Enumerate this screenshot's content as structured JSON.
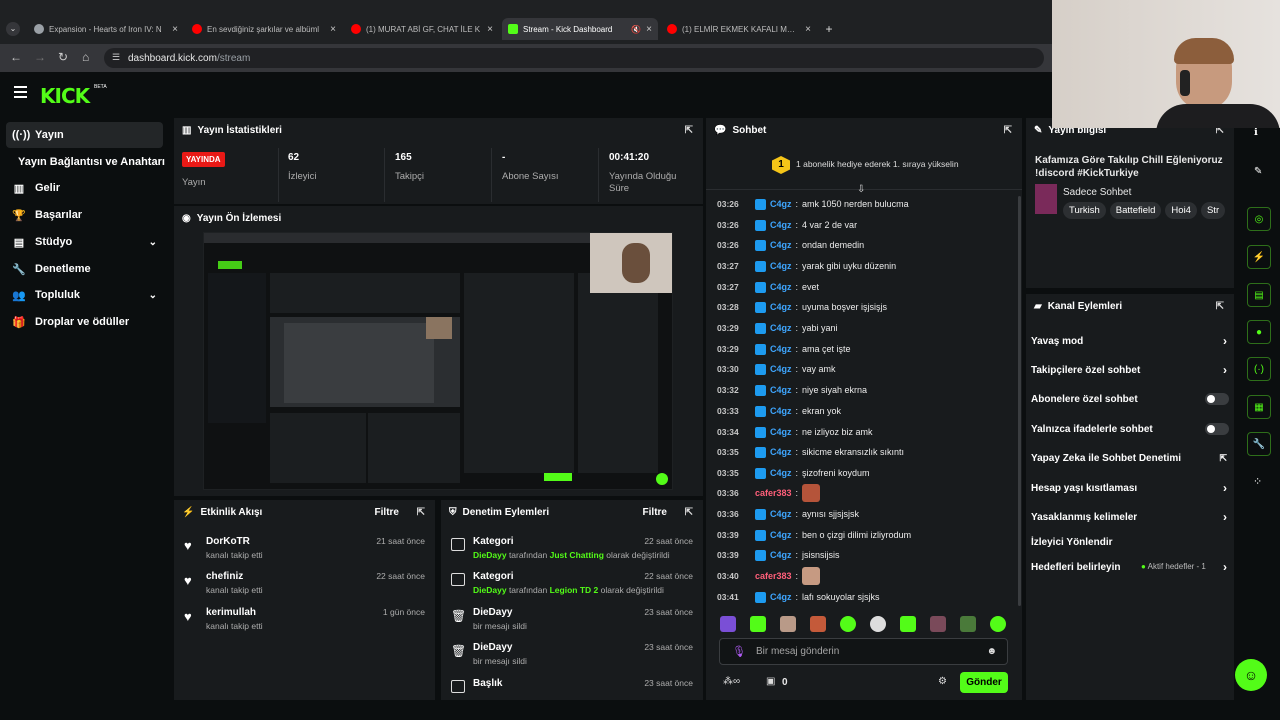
{
  "browser": {
    "tabs": [
      {
        "title": "Expansion - Hearts of Iron IV: N",
        "color": "#9aa0a6"
      },
      {
        "title": "En sevdiğiniz şarkılar ve albüml",
        "color": "#ff0000"
      },
      {
        "title": "(1) MURAT ABİ GF, CHAT İLE K",
        "color": "#ff0000"
      },
      {
        "title": "Stream - Kick Dashboard",
        "color": "#53fc18"
      },
      {
        "title": "(1) ELMİR EKMEK KAFALI MEVZ",
        "color": "#ff0000"
      }
    ],
    "url_host": "dashboard.kick.com",
    "url_path": "/stream"
  },
  "kick": {
    "logo": "KICK",
    "beta": "BETA"
  },
  "sidebar": {
    "items": [
      {
        "label": "Yayın",
        "icon": "broadcast-icon"
      },
      {
        "label": "Yayın Bağlantısı ve Anahtarı",
        "icon": ""
      },
      {
        "label": "Gelir",
        "icon": "chart-icon"
      },
      {
        "label": "Başarılar",
        "icon": "trophy-icon"
      },
      {
        "label": "Stüdyo",
        "icon": "studio-icon"
      },
      {
        "label": "Denetleme",
        "icon": "wrench-icon"
      },
      {
        "label": "Topluluk",
        "icon": "people-icon"
      },
      {
        "label": "Droplar ve ödüller",
        "icon": "gift-icon"
      }
    ]
  },
  "stats": {
    "title": "Yayın İstatistikleri",
    "live_badge": "YAYINDA",
    "live_label": "Yayın",
    "viewers": "62",
    "viewers_label": "İzleyici",
    "followers": "165",
    "followers_label": "Takipçi",
    "subs": "-",
    "subs_label": "Abone Sayısı",
    "uptime": "00:41:20",
    "uptime_label": "Yayında Olduğu Süre"
  },
  "preview": {
    "title": "Yayın Ön İzlemesi"
  },
  "activity": {
    "title": "Etkinlik Akışı",
    "filter": "Filtre",
    "items": [
      {
        "name": "DorKoTR",
        "desc": "kanalı takip etti",
        "time": "21 saat önce"
      },
      {
        "name": "chefiniz",
        "desc": "kanalı takip etti",
        "time": "22 saat önce"
      },
      {
        "name": "kerimullah",
        "desc": "kanalı takip etti",
        "time": "1 gün önce"
      }
    ]
  },
  "moderation": {
    "title": "Denetim Eylemleri",
    "filter": "Filtre",
    "items": [
      {
        "name": "Kategori",
        "actor": "DieDayy",
        "mid": "tarafından",
        "target": "Just Chatting",
        "tail": "olarak değiştirildi",
        "time": "22 saat önce"
      },
      {
        "name": "Kategori",
        "actor": "DieDayy",
        "mid": "tarafından",
        "target": "Legion TD 2",
        "tail": "olarak değiştirildi",
        "time": "22 saat önce"
      },
      {
        "name": "DieDayy",
        "actor": "",
        "mid": "bir mesajı sildi",
        "target": "",
        "tail": "",
        "time": "23 saat önce"
      },
      {
        "name": "DieDayy",
        "actor": "",
        "mid": "bir mesajı sildi",
        "target": "",
        "tail": "",
        "time": "23 saat önce"
      },
      {
        "name": "Başlık",
        "actor": "",
        "mid": "",
        "target": "",
        "tail": "",
        "time": "23 saat önce"
      }
    ]
  },
  "chat": {
    "title": "Sohbet",
    "pinned_rank": "1",
    "pinned": "1 abonelik hediye ederek 1. sıraya yükselin",
    "messages": [
      {
        "time": "03:26",
        "user": "C4gz",
        "text": "amk 1050 nerden bulucma",
        "color": "#3ea6ff"
      },
      {
        "time": "03:26",
        "user": "C4gz",
        "text": "4 var 2 de var",
        "color": "#3ea6ff"
      },
      {
        "time": "03:26",
        "user": "C4gz",
        "text": "ondan demedin",
        "color": "#3ea6ff"
      },
      {
        "time": "03:27",
        "user": "C4gz",
        "text": "yarak gibi uyku düzenin",
        "color": "#3ea6ff"
      },
      {
        "time": "03:27",
        "user": "C4gz",
        "text": "evet",
        "color": "#3ea6ff"
      },
      {
        "time": "03:28",
        "user": "C4gz",
        "text": "uyuma boşver işjsişjs",
        "color": "#3ea6ff"
      },
      {
        "time": "03:29",
        "user": "C4gz",
        "text": "yabi yani",
        "color": "#3ea6ff"
      },
      {
        "time": "03:29",
        "user": "C4gz",
        "text": "ama çet işte",
        "color": "#3ea6ff"
      },
      {
        "time": "03:30",
        "user": "C4gz",
        "text": "vay amk",
        "color": "#3ea6ff"
      },
      {
        "time": "03:32",
        "user": "C4gz",
        "text": "niye siyah ekrna",
        "color": "#3ea6ff"
      },
      {
        "time": "03:33",
        "user": "C4gz",
        "text": "ekran yok",
        "color": "#3ea6ff"
      },
      {
        "time": "03:34",
        "user": "C4gz",
        "text": "ne izliyoz biz amk",
        "color": "#3ea6ff"
      },
      {
        "time": "03:35",
        "user": "C4gz",
        "text": "sikicme ekransızlık sıkıntı",
        "color": "#3ea6ff"
      },
      {
        "time": "03:35",
        "user": "C4gz",
        "text": "şizofreni koydum",
        "color": "#3ea6ff"
      },
      {
        "time": "03:36",
        "user": "cafer383",
        "text": "",
        "color": "#ff5f7a"
      },
      {
        "time": "03:36",
        "user": "C4gz",
        "text": "aynısı sjjsjsjsk",
        "color": "#3ea6ff"
      },
      {
        "time": "03:39",
        "user": "C4gz",
        "text": "ben o çizgi dilimi izliyrodum",
        "color": "#3ea6ff"
      },
      {
        "time": "03:39",
        "user": "C4gz",
        "text": "jsisnsijsis",
        "color": "#3ea6ff"
      },
      {
        "time": "03:40",
        "user": "cafer383",
        "text": "",
        "color": "#ff5f7a"
      },
      {
        "time": "03:41",
        "user": "C4gz",
        "text": "lafı sokuyolar sjsjks",
        "color": "#3ea6ff"
      }
    ],
    "input_placeholder": "Bir mesaj gönderin",
    "send": "Gönder",
    "points": "0"
  },
  "info": {
    "title": "Yayın bilgisi",
    "stream_title": "Kafamıza Göre Takılıp Chill Eğleniyoruz !discord #KickTurkiye",
    "category": "Sadece Sohbet",
    "tags": [
      "Turkish",
      "Battefield",
      "Hoi4",
      "Str"
    ]
  },
  "channel_actions": {
    "title": "Kanal Eylemleri",
    "items": [
      {
        "label": "Yavaş mod",
        "kind": "arrow"
      },
      {
        "label": "Takipçilere özel sohbet",
        "kind": "arrow"
      },
      {
        "label": "Abonelere özel sohbet",
        "kind": "toggle"
      },
      {
        "label": "Yalnızca ifadelerle sohbet",
        "kind": "toggle"
      },
      {
        "label": "Yapay Zeka ile Sohbet Denetimi",
        "kind": "ext"
      },
      {
        "label": "Hesap yaşı kısıtlaması",
        "kind": "arrow"
      },
      {
        "label": "Yasaklanmış kelimeler",
        "kind": "arrow"
      },
      {
        "label": "İzleyici Yönlendir",
        "kind": "none"
      },
      {
        "label": "Hedefleri belirleyin",
        "kind": "arrow"
      }
    ],
    "goal_status": "Aktif hedefler - 1"
  },
  "colors": {
    "accent": "#53fc18",
    "live": "#e91916",
    "bg": "#0b0e0f",
    "panel": "#181b1d"
  }
}
